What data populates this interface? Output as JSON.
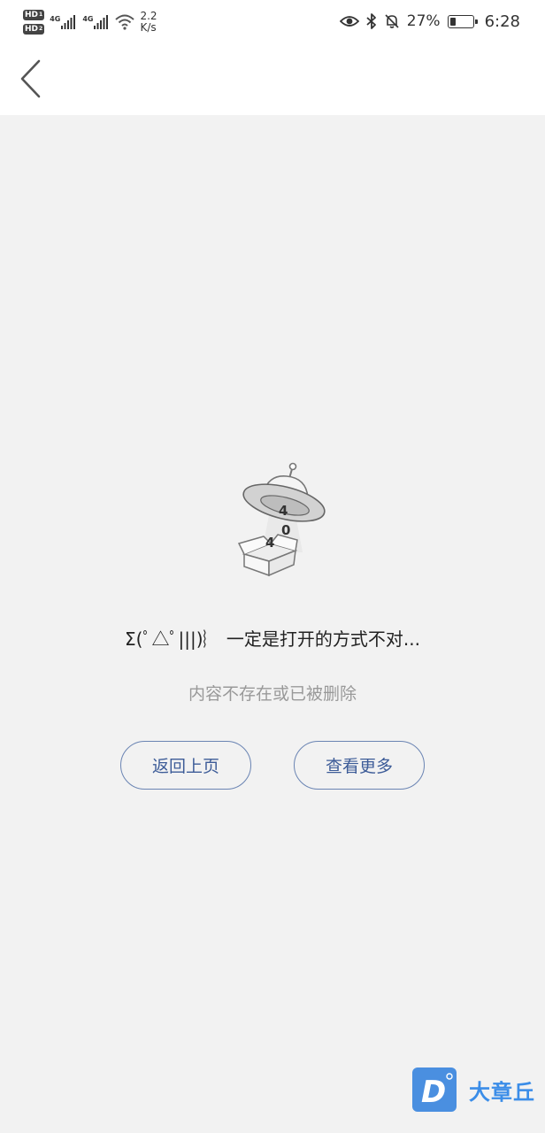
{
  "status_bar": {
    "sim1_label": "HD",
    "sim1_index": "1",
    "sim2_label": "HD",
    "sim2_index": "2",
    "network1": "4G",
    "network2": "4G",
    "speed_value": "2.2",
    "speed_unit": "K/s",
    "battery_percent": "27%",
    "battery_level": 0.27,
    "time": "6:28",
    "icons": [
      "eye-icon",
      "bluetooth-icon",
      "bell-muted-icon",
      "battery-icon",
      "wifi-icon",
      "signal-icon"
    ]
  },
  "nav": {
    "back_icon": "chevron-left-icon"
  },
  "illustration": {
    "digit_1": "4",
    "digit_2": "0",
    "digit_3": "4"
  },
  "error": {
    "title": "Σ(ﾟ△ﾟ|||)︴ 一定是打开的方式不对...",
    "subtitle": "内容不存在或已被删除"
  },
  "buttons": {
    "back_label": "返回上页",
    "more_label": "查看更多"
  },
  "watermark": {
    "logo_letter": "D",
    "text": "大章丘"
  },
  "colors": {
    "background": "#f2f2f2",
    "button_border": "#6a84b3",
    "button_text": "#3d5c98",
    "subtitle_text": "#999999",
    "watermark_blue": "#3b8de8"
  }
}
